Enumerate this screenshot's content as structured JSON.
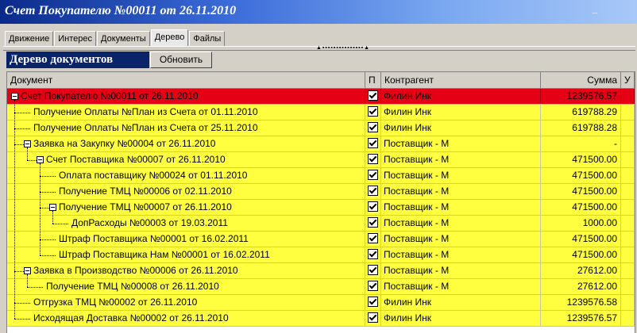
{
  "window": {
    "title": "Счет Покупателю №00011 от 26.11.2010",
    "minimize": "_"
  },
  "tabs": [
    {
      "label": "Движение"
    },
    {
      "label": "Интерес"
    },
    {
      "label": "Документы"
    },
    {
      "label": "Дерево",
      "active": true
    },
    {
      "label": "Файлы"
    }
  ],
  "panel": {
    "title": "Дерево документов",
    "refresh_label": "Обновить"
  },
  "columns": {
    "document": "Документ",
    "plan": "П",
    "contractor": "Контрагент",
    "sum": "Сумма",
    "u": "У"
  },
  "rows": [
    {
      "doc": "Счет Покупателю №00011 от 26.11.2010",
      "level": 0,
      "expandable": true,
      "checked": true,
      "contractor": "Филин Инк",
      "sum": "1239576.57",
      "color": "#e60016"
    },
    {
      "doc": "Получение Оплаты №План из Счета от 01.11.2010",
      "level": 1,
      "expandable": false,
      "checked": true,
      "contractor": "Филин Инк",
      "sum": "619788.29",
      "color": "#ffff40"
    },
    {
      "doc": "Получение Оплаты №План из Счета от 25.11.2010",
      "level": 1,
      "expandable": false,
      "checked": true,
      "contractor": "Филин Инк",
      "sum": "619788.28",
      "color": "#ffff40"
    },
    {
      "doc": "Заявка на Закупку №00004 от 26.11.2010",
      "level": 1,
      "expandable": true,
      "checked": true,
      "contractor": "Поставщик - М",
      "sum": "-",
      "color": "#ffff40"
    },
    {
      "doc": "Счет Поставщика №00007 от 26.11.2010",
      "level": 2,
      "expandable": true,
      "checked": true,
      "contractor": "Поставщик - М",
      "sum": "471500.00",
      "color": "#ffff40"
    },
    {
      "doc": "Оплата поставщику №00024 от 01.11.2010",
      "level": 3,
      "expandable": false,
      "checked": true,
      "contractor": "Поставщик - М",
      "sum": "471500.00",
      "color": "#ffff40"
    },
    {
      "doc": "Получение ТМЦ №00006 от 02.11.2010",
      "level": 3,
      "expandable": false,
      "checked": true,
      "contractor": "Поставщик - М",
      "sum": "471500.00",
      "color": "#ffff40"
    },
    {
      "doc": "Получение ТМЦ №00007 от 26.11.2010",
      "level": 3,
      "expandable": true,
      "checked": true,
      "contractor": "Поставщик - М",
      "sum": "471500.00",
      "color": "#ffff40"
    },
    {
      "doc": "ДопРасходы №00003 от 19.03.2011",
      "level": 4,
      "expandable": false,
      "checked": true,
      "contractor": "Поставщик - М",
      "sum": "1000.00",
      "color": "#ffff40"
    },
    {
      "doc": "Штраф Поставщика №00001 от 16.02.2011",
      "level": 3,
      "expandable": false,
      "checked": true,
      "contractor": "Поставщик - М",
      "sum": "471500.00",
      "color": "#ffff40"
    },
    {
      "doc": "Штраф Поставщика Нам №00001 от 16.02.2011",
      "level": 3,
      "expandable": false,
      "checked": true,
      "contractor": "Поставщик - М",
      "sum": "471500.00",
      "color": "#ffff40"
    },
    {
      "doc": "Заявка в Производство №00006 от 26.11.2010",
      "level": 1,
      "expandable": true,
      "checked": true,
      "contractor": "Поставщик - М",
      "sum": "27612.00",
      "color": "#ffff40"
    },
    {
      "doc": "Получение ТМЦ №00008 от 26.11.2010",
      "level": 2,
      "expandable": false,
      "checked": true,
      "contractor": "Поставщик - М",
      "sum": "27612.00",
      "color": "#ffff40"
    },
    {
      "doc": "Отгрузка ТМЦ №00002 от 26.11.2010",
      "level": 1,
      "expandable": false,
      "checked": true,
      "contractor": "Филин Инк",
      "sum": "1239576.58",
      "color": "#ffff40"
    },
    {
      "doc": "Исходящая Доставка №00002 от 26.11.2010",
      "level": 1,
      "expandable": false,
      "checked": true,
      "contractor": "Филин Инк",
      "sum": "1239576.57",
      "color": "#ffff40"
    }
  ]
}
